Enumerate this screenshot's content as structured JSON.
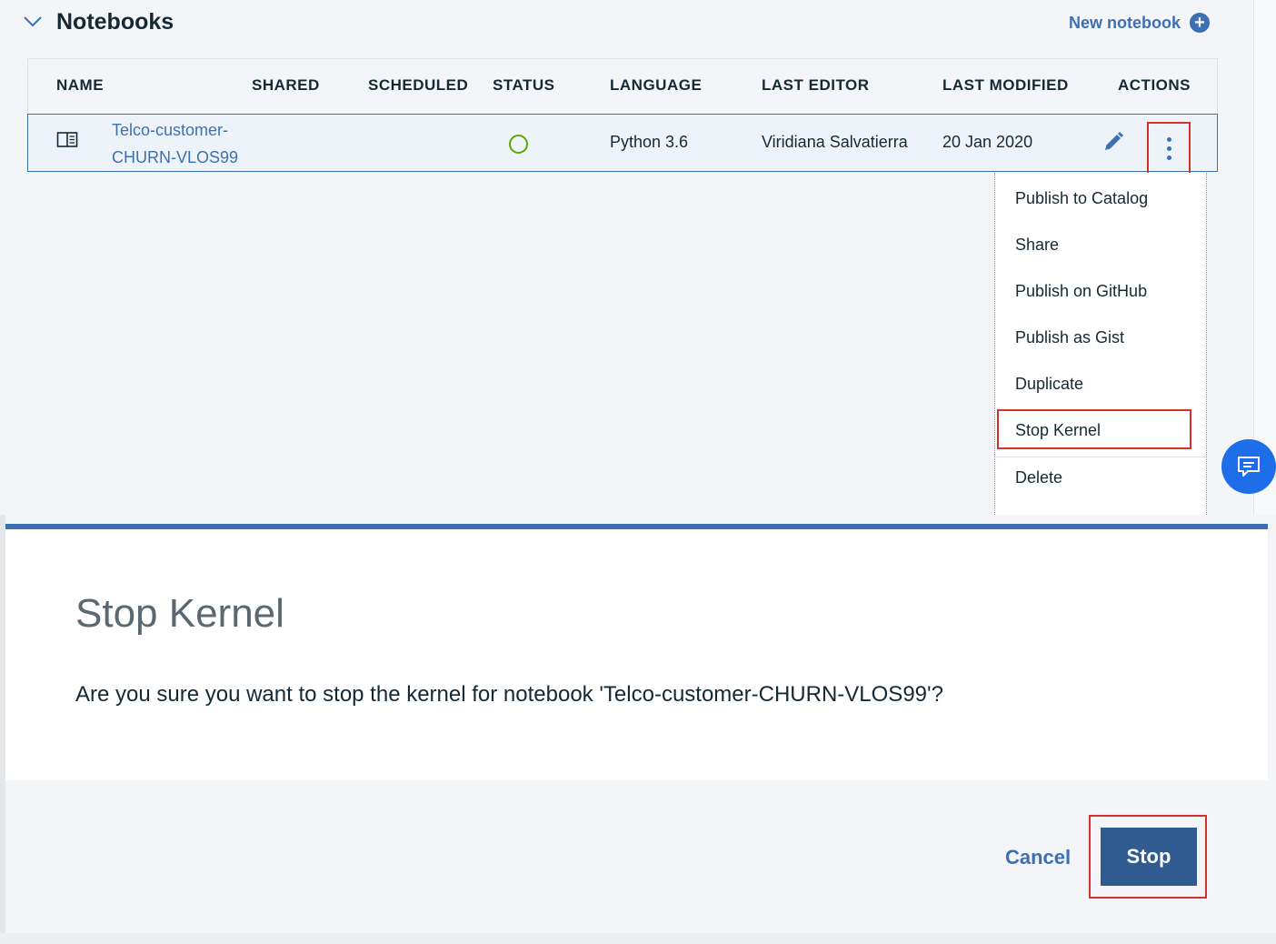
{
  "section": {
    "title": "Notebooks",
    "new_notebook_label": "New notebook"
  },
  "table": {
    "headers": {
      "name": "NAME",
      "shared": "SHARED",
      "scheduled": "SCHEDULED",
      "status": "STATUS",
      "language": "LANGUAGE",
      "last_editor": "LAST EDITOR",
      "last_modified": "LAST MODIFIED",
      "actions": "ACTIONS"
    },
    "rows": [
      {
        "name_line1": "Telco-customer-",
        "name_line2": "CHURN-VLOS99",
        "status_icon": "circle-icon",
        "language": "Python 3.6",
        "last_editor": "Viridiana Salvatierra",
        "last_modified": "20 Jan 2020"
      }
    ]
  },
  "menu": {
    "items": [
      "Publish to Catalog",
      "Share",
      "Publish on GitHub",
      "Publish as Gist",
      "Duplicate",
      "Stop Kernel",
      "Delete"
    ]
  },
  "modal": {
    "title": "Stop Kernel",
    "body": "Are you sure you want to stop the kernel for notebook 'Telco-customer-CHURN-VLOS99'?",
    "cancel_label": "Cancel",
    "confirm_label": "Stop"
  },
  "colors": {
    "accent": "#3d70b2",
    "highlight": "#d3322a",
    "status_ok": "#5aa700",
    "chat": "#1d6ee8",
    "primary_button": "#2f5b91"
  }
}
